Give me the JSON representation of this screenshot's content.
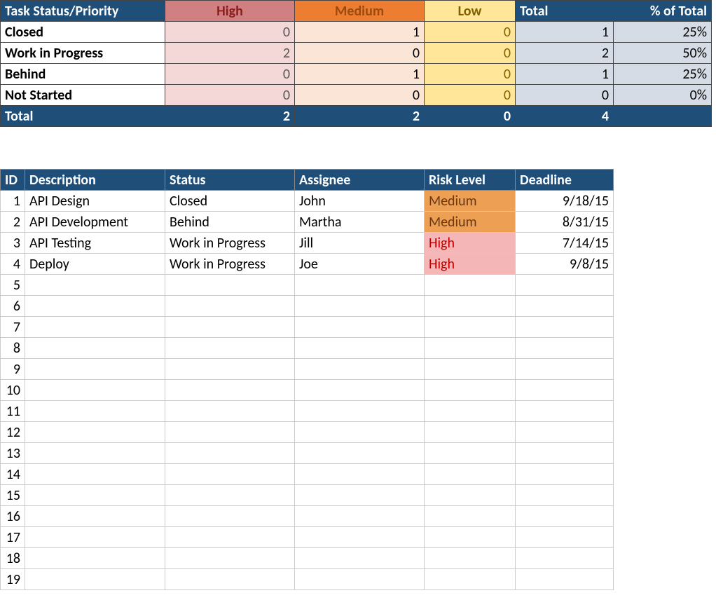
{
  "summary": {
    "headers": {
      "status": "Task Status/Priority",
      "high": "High",
      "medium": "Medium",
      "low": "Low",
      "total": "Total",
      "pct": "% of Total"
    },
    "rows": [
      {
        "label": "Closed",
        "high": "0",
        "med": "1",
        "low": "0",
        "total": "1",
        "pct": "25%"
      },
      {
        "label": "Work in Progress",
        "high": "2",
        "med": "0",
        "low": "0",
        "total": "2",
        "pct": "50%"
      },
      {
        "label": "Behind",
        "high": "0",
        "med": "1",
        "low": "0",
        "total": "1",
        "pct": "25%"
      },
      {
        "label": "Not Started",
        "high": "0",
        "med": "0",
        "low": "0",
        "total": "0",
        "pct": "0%"
      }
    ],
    "totals": {
      "label": "Total",
      "high": "2",
      "med": "2",
      "low": "0",
      "total": "4",
      "pct": ""
    }
  },
  "tasks": {
    "headers": {
      "id": "ID",
      "desc": "Description",
      "status": "Status",
      "assignee": "Assignee",
      "risk": "Risk Level",
      "deadline": "Deadline"
    },
    "rows": [
      {
        "id": "1",
        "desc": "API Design",
        "status": "Closed",
        "assignee": "John",
        "risk": "Medium",
        "risk_class": "risk-med",
        "deadline": "9/18/15"
      },
      {
        "id": "2",
        "desc": "API Development",
        "status": "Behind",
        "assignee": "Martha",
        "risk": "Medium",
        "risk_class": "risk-med",
        "deadline": "8/31/15"
      },
      {
        "id": "3",
        "desc": "API Testing",
        "status": "Work in Progress",
        "assignee": "Jill",
        "risk": "High",
        "risk_class": "risk-high",
        "deadline": "7/14/15"
      },
      {
        "id": "4",
        "desc": "Deploy",
        "status": "Work in Progress",
        "assignee": "Joe",
        "risk": "High",
        "risk_class": "risk-high",
        "deadline": "9/8/15"
      },
      {
        "id": "5"
      },
      {
        "id": "6"
      },
      {
        "id": "7"
      },
      {
        "id": "8"
      },
      {
        "id": "9"
      },
      {
        "id": "10"
      },
      {
        "id": "11"
      },
      {
        "id": "12"
      },
      {
        "id": "13"
      },
      {
        "id": "14"
      },
      {
        "id": "15"
      },
      {
        "id": "16"
      },
      {
        "id": "17"
      },
      {
        "id": "18"
      },
      {
        "id": "19"
      }
    ]
  }
}
